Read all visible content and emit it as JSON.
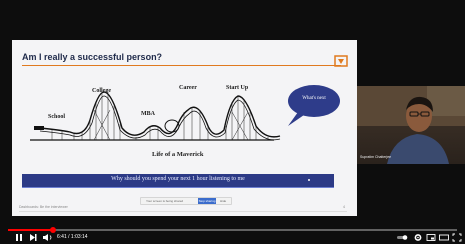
{
  "slide": {
    "title": "Am I really a successful person?",
    "labels": {
      "school": "School",
      "college": "College",
      "mba": "MBA",
      "career": "Career",
      "startup": "Start Up"
    },
    "caption": "Life of a Maverick",
    "bubble_text": "What's next",
    "banner": "Why should you spend your next 1 hour listening to me",
    "footer_left": "Dashboards: Be the interviewer",
    "footer_right": "4"
  },
  "share_bar": {
    "text": "Your screen is being shared",
    "button": "Stop sharing",
    "hide": "Hide"
  },
  "presenter": {
    "name": "Supratim Chatterjee"
  },
  "player": {
    "progress": 0.1,
    "time": "6:41 / 1:03:14",
    "icons": {
      "play": "pause-icon",
      "next": "next-icon",
      "volume": "volume-icon",
      "toggle": "autoplay-toggle-icon",
      "settings": "gear-icon",
      "miniplayer": "miniplayer-icon",
      "theater": "theater-icon",
      "fullscreen": "fullscreen-icon"
    }
  },
  "colors": {
    "accent": "#e07a1f",
    "banner": "#2c3a86",
    "bubble": "#2e3c8a",
    "progress": "#ff0000"
  }
}
